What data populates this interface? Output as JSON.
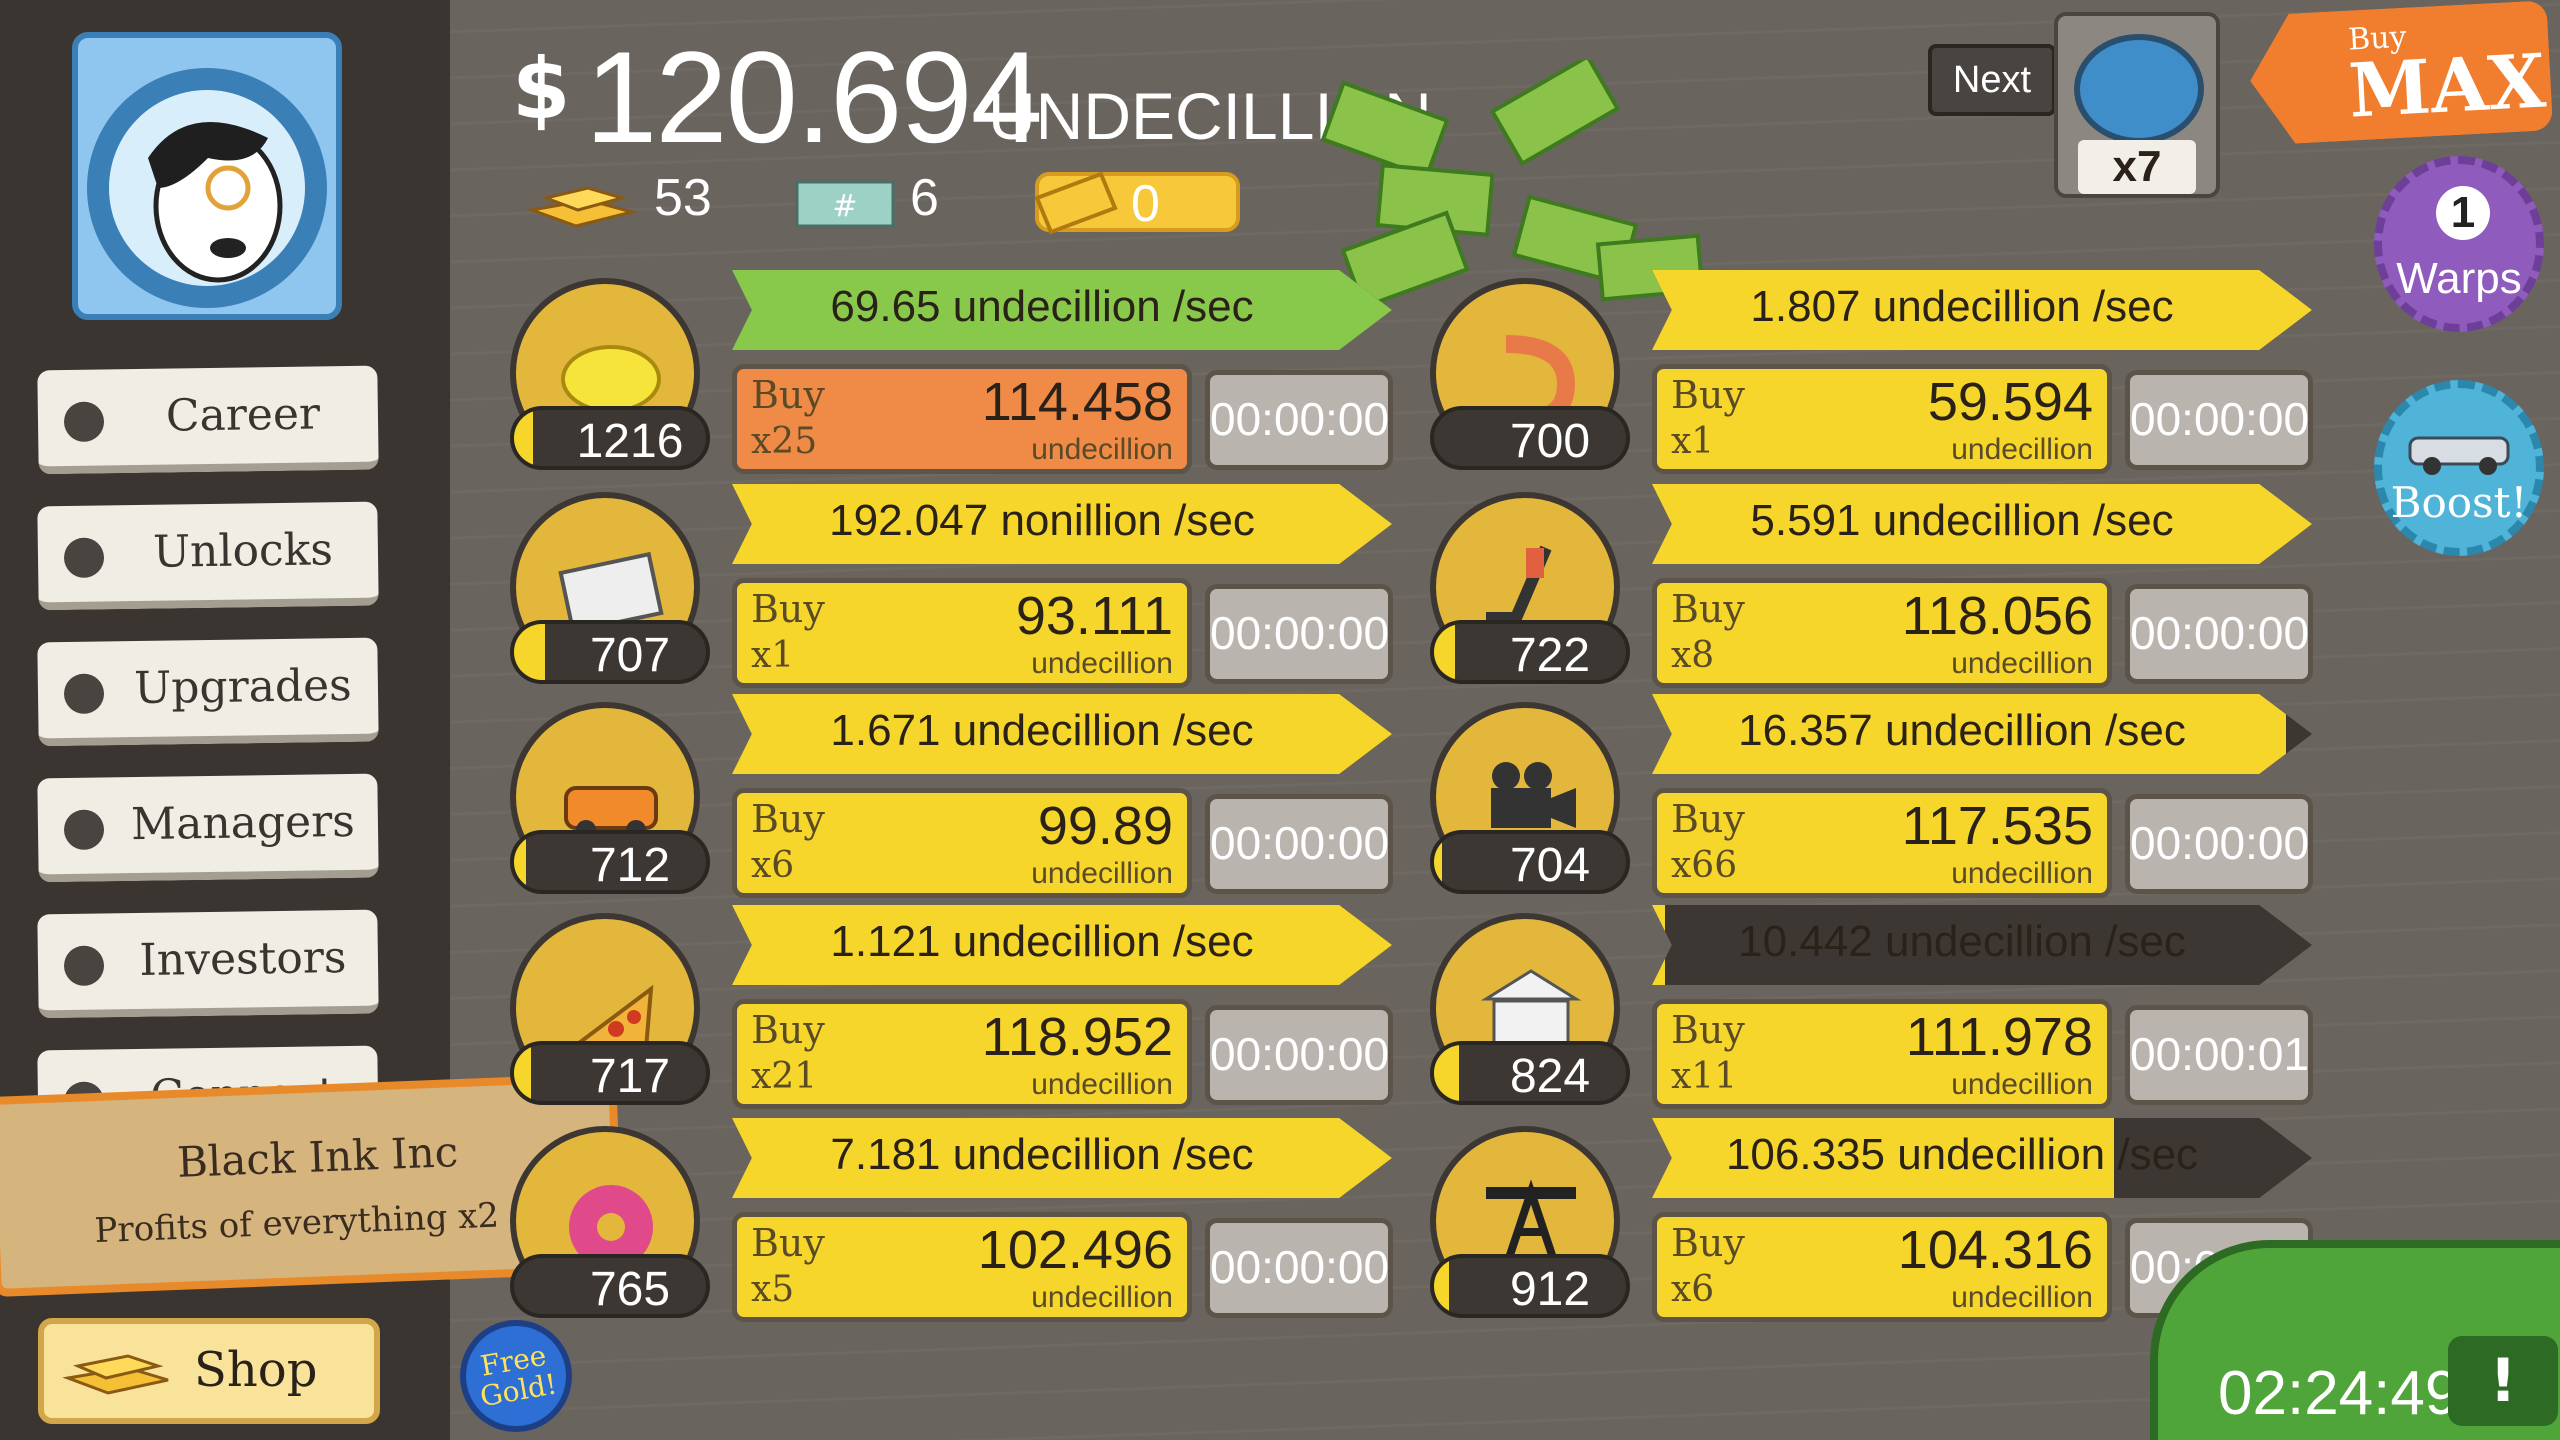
{
  "header": {
    "cash_symbol": "$",
    "cash_amount": "120.694",
    "cash_unit": "UNDECILLION",
    "gold": "53",
    "megabucks": "6",
    "tickets": "0"
  },
  "sidebar": {
    "items": [
      {
        "label": "Career"
      },
      {
        "label": "Unlocks"
      },
      {
        "label": "Upgrades"
      },
      {
        "label": "Managers"
      },
      {
        "label": "Investors"
      },
      {
        "label": "Connect"
      }
    ],
    "shop_label": "Shop",
    "free_gold": "Free Gold!"
  },
  "notification": {
    "title": "Black Ink Inc",
    "text": "Profits of everything x2"
  },
  "next": {
    "label": "Next",
    "multiplier": "x7"
  },
  "buy_max": {
    "top": "Buy",
    "main": "MAX"
  },
  "warps": {
    "count": "1",
    "label": "Warps"
  },
  "boost": {
    "label": "Boost!"
  },
  "timer_main": "02:24:49",
  "businesses": [
    {
      "icon": "lemon-icon",
      "owned": "1216",
      "owned_progress": 0.1,
      "rate": "69.65 undecillion /sec",
      "rate_progress": 1.0,
      "buy_label": "Buy",
      "buy_multiplier": "x25",
      "cost": "114.458",
      "cost_unit": "undecillion",
      "time": "00:00:00",
      "highlight": "#ef8a47",
      "rate_color": "#88c94b"
    },
    {
      "icon": "shrimp-icon",
      "owned": "700",
      "owned_progress": 0.0,
      "rate": "1.807 undecillion /sec",
      "rate_progress": 1.0,
      "buy_label": "Buy",
      "buy_multiplier": "x1",
      "cost": "59.594",
      "cost_unit": "undecillion",
      "time": "00:00:00"
    },
    {
      "icon": "newspaper-icon",
      "owned": "707",
      "owned_progress": 0.16,
      "rate": "192.047 nonillion /sec",
      "rate_progress": 1.0,
      "buy_label": "Buy",
      "buy_multiplier": "x1",
      "cost": "93.111",
      "cost_unit": "undecillion",
      "time": "00:00:00"
    },
    {
      "icon": "hockey-icon",
      "owned": "722",
      "owned_progress": 0.11,
      "rate": "5.591 undecillion /sec",
      "rate_progress": 1.0,
      "buy_label": "Buy",
      "buy_multiplier": "x8",
      "cost": "118.056",
      "cost_unit": "undecillion",
      "time": "00:00:00"
    },
    {
      "icon": "car-icon",
      "owned": "712",
      "owned_progress": 0.06,
      "rate": "1.671 undecillion /sec",
      "rate_progress": 1.0,
      "buy_label": "Buy",
      "buy_multiplier": "x6",
      "cost": "99.89",
      "cost_unit": "undecillion",
      "time": "00:00:00"
    },
    {
      "icon": "camera-icon",
      "owned": "704",
      "owned_progress": 0.04,
      "rate": "16.357 undecillion /sec",
      "rate_progress": 0.96,
      "buy_label": "Buy",
      "buy_multiplier": "x66",
      "cost": "117.535",
      "cost_unit": "undecillion",
      "time": "00:00:00"
    },
    {
      "icon": "pizza-icon",
      "owned": "717",
      "owned_progress": 0.09,
      "rate": "1.121 undecillion /sec",
      "rate_progress": 1.0,
      "buy_label": "Buy",
      "buy_multiplier": "x21",
      "cost": "118.952",
      "cost_unit": "undecillion",
      "time": "00:00:00"
    },
    {
      "icon": "bank-icon",
      "owned": "824",
      "owned_progress": 0.13,
      "rate": "10.442 undecillion /sec",
      "rate_progress": 0.02,
      "buy_label": "Buy",
      "buy_multiplier": "x11",
      "cost": "111.978",
      "cost_unit": "undecillion",
      "time": "00:00:01"
    },
    {
      "icon": "donut-icon",
      "owned": "765",
      "owned_progress": 0.0,
      "rate": "7.181 undecillion /sec",
      "rate_progress": 1.0,
      "buy_label": "Buy",
      "buy_multiplier": "x5",
      "cost": "102.496",
      "cost_unit": "undecillion",
      "time": "00:00:00"
    },
    {
      "icon": "oil-rig-icon",
      "owned": "912",
      "owned_progress": 0.08,
      "rate": "106.335 undecillion /sec",
      "rate_progress": 0.7,
      "buy_label": "Buy",
      "buy_multiplier": "x6",
      "cost": "104.316",
      "cost_unit": "undecillion",
      "time": "00:00:02"
    }
  ]
}
